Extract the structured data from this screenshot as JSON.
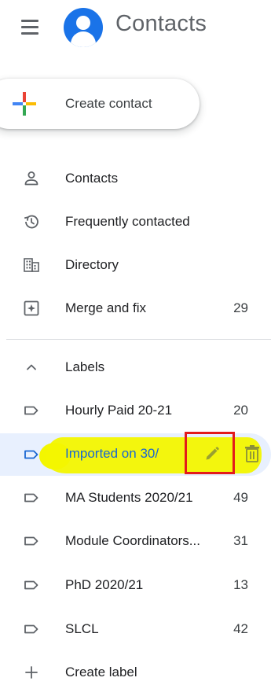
{
  "header": {
    "app_title": "Contacts",
    "menu_icon": "hamburger-menu-icon",
    "logo_icon": "contacts-logo-icon"
  },
  "create_button": {
    "label": "Create contact",
    "icon": "multicolor-plus-icon"
  },
  "nav": {
    "items": [
      {
        "label": "Contacts",
        "icon": "person-icon",
        "count": ""
      },
      {
        "label": "Frequently contacted",
        "icon": "history-icon",
        "count": ""
      },
      {
        "label": "Directory",
        "icon": "building-icon",
        "count": ""
      },
      {
        "label": "Merge and fix",
        "icon": "merge-fix-icon",
        "count": "29"
      }
    ]
  },
  "labels": {
    "header": "Labels",
    "header_icon": "chevron-up-icon",
    "items": [
      {
        "label": "Hourly Paid 20-21",
        "count": "20"
      },
      {
        "label": "Imported on 30/",
        "count": "",
        "highlighted": true
      },
      {
        "label": "MA Students 2020/21",
        "count": "49"
      },
      {
        "label": "Module Coordinators...",
        "count": "31"
      },
      {
        "label": "PhD 2020/21",
        "count": "13"
      },
      {
        "label": "SLCL",
        "count": "42"
      }
    ],
    "create_label": "Create label",
    "create_icon": "plus-icon",
    "item_icon": "label-tag-icon",
    "edit_icon": "pencil-icon",
    "delete_icon": "trash-icon"
  },
  "colors": {
    "accent": "#1a73e8",
    "highlight_bg": "#e8f0fe",
    "marker_yellow": "#f3f600",
    "annotation_red": "#e31b1b",
    "edit_green": "#9aa030"
  }
}
